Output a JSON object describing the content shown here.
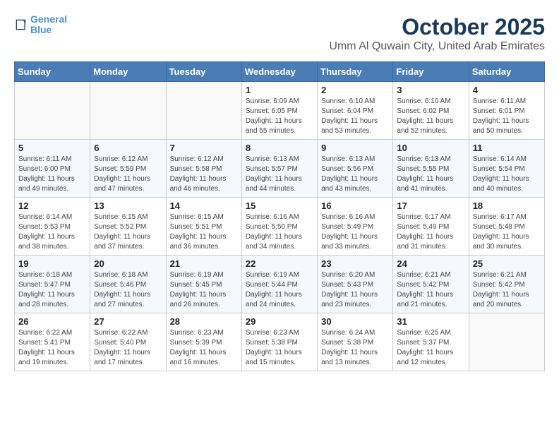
{
  "header": {
    "logo_line1": "General",
    "logo_line2": "Blue",
    "month_title": "October 2025",
    "location": "Umm Al Quwain City, United Arab Emirates"
  },
  "weekdays": [
    "Sunday",
    "Monday",
    "Tuesday",
    "Wednesday",
    "Thursday",
    "Friday",
    "Saturday"
  ],
  "weeks": [
    [
      {
        "day": "",
        "sunrise": "",
        "sunset": "",
        "daylight": ""
      },
      {
        "day": "",
        "sunrise": "",
        "sunset": "",
        "daylight": ""
      },
      {
        "day": "",
        "sunrise": "",
        "sunset": "",
        "daylight": ""
      },
      {
        "day": "1",
        "sunrise": "Sunrise: 6:09 AM",
        "sunset": "Sunset: 6:05 PM",
        "daylight": "Daylight: 11 hours and 55 minutes."
      },
      {
        "day": "2",
        "sunrise": "Sunrise: 6:10 AM",
        "sunset": "Sunset: 6:04 PM",
        "daylight": "Daylight: 11 hours and 53 minutes."
      },
      {
        "day": "3",
        "sunrise": "Sunrise: 6:10 AM",
        "sunset": "Sunset: 6:02 PM",
        "daylight": "Daylight: 11 hours and 52 minutes."
      },
      {
        "day": "4",
        "sunrise": "Sunrise: 6:11 AM",
        "sunset": "Sunset: 6:01 PM",
        "daylight": "Daylight: 11 hours and 50 minutes."
      }
    ],
    [
      {
        "day": "5",
        "sunrise": "Sunrise: 6:11 AM",
        "sunset": "Sunset: 6:00 PM",
        "daylight": "Daylight: 11 hours and 49 minutes."
      },
      {
        "day": "6",
        "sunrise": "Sunrise: 6:12 AM",
        "sunset": "Sunset: 5:59 PM",
        "daylight": "Daylight: 11 hours and 47 minutes."
      },
      {
        "day": "7",
        "sunrise": "Sunrise: 6:12 AM",
        "sunset": "Sunset: 5:58 PM",
        "daylight": "Daylight: 11 hours and 46 minutes."
      },
      {
        "day": "8",
        "sunrise": "Sunrise: 6:13 AM",
        "sunset": "Sunset: 5:57 PM",
        "daylight": "Daylight: 11 hours and 44 minutes."
      },
      {
        "day": "9",
        "sunrise": "Sunrise: 6:13 AM",
        "sunset": "Sunset: 5:56 PM",
        "daylight": "Daylight: 11 hours and 43 minutes."
      },
      {
        "day": "10",
        "sunrise": "Sunrise: 6:13 AM",
        "sunset": "Sunset: 5:55 PM",
        "daylight": "Daylight: 11 hours and 41 minutes."
      },
      {
        "day": "11",
        "sunrise": "Sunrise: 6:14 AM",
        "sunset": "Sunset: 5:54 PM",
        "daylight": "Daylight: 11 hours and 40 minutes."
      }
    ],
    [
      {
        "day": "12",
        "sunrise": "Sunrise: 6:14 AM",
        "sunset": "Sunset: 5:53 PM",
        "daylight": "Daylight: 11 hours and 38 minutes."
      },
      {
        "day": "13",
        "sunrise": "Sunrise: 6:15 AM",
        "sunset": "Sunset: 5:52 PM",
        "daylight": "Daylight: 11 hours and 37 minutes."
      },
      {
        "day": "14",
        "sunrise": "Sunrise: 6:15 AM",
        "sunset": "Sunset: 5:51 PM",
        "daylight": "Daylight: 11 hours and 36 minutes."
      },
      {
        "day": "15",
        "sunrise": "Sunrise: 6:16 AM",
        "sunset": "Sunset: 5:50 PM",
        "daylight": "Daylight: 11 hours and 34 minutes."
      },
      {
        "day": "16",
        "sunrise": "Sunrise: 6:16 AM",
        "sunset": "Sunset: 5:49 PM",
        "daylight": "Daylight: 11 hours and 33 minutes."
      },
      {
        "day": "17",
        "sunrise": "Sunrise: 6:17 AM",
        "sunset": "Sunset: 5:49 PM",
        "daylight": "Daylight: 11 hours and 31 minutes."
      },
      {
        "day": "18",
        "sunrise": "Sunrise: 6:17 AM",
        "sunset": "Sunset: 5:48 PM",
        "daylight": "Daylight: 11 hours and 30 minutes."
      }
    ],
    [
      {
        "day": "19",
        "sunrise": "Sunrise: 6:18 AM",
        "sunset": "Sunset: 5:47 PM",
        "daylight": "Daylight: 11 hours and 28 minutes."
      },
      {
        "day": "20",
        "sunrise": "Sunrise: 6:18 AM",
        "sunset": "Sunset: 5:46 PM",
        "daylight": "Daylight: 11 hours and 27 minutes."
      },
      {
        "day": "21",
        "sunrise": "Sunrise: 6:19 AM",
        "sunset": "Sunset: 5:45 PM",
        "daylight": "Daylight: 11 hours and 26 minutes."
      },
      {
        "day": "22",
        "sunrise": "Sunrise: 6:19 AM",
        "sunset": "Sunset: 5:44 PM",
        "daylight": "Daylight: 11 hours and 24 minutes."
      },
      {
        "day": "23",
        "sunrise": "Sunrise: 6:20 AM",
        "sunset": "Sunset: 5:43 PM",
        "daylight": "Daylight: 11 hours and 23 minutes."
      },
      {
        "day": "24",
        "sunrise": "Sunrise: 6:21 AM",
        "sunset": "Sunset: 5:42 PM",
        "daylight": "Daylight: 11 hours and 21 minutes."
      },
      {
        "day": "25",
        "sunrise": "Sunrise: 6:21 AM",
        "sunset": "Sunset: 5:42 PM",
        "daylight": "Daylight: 11 hours and 20 minutes."
      }
    ],
    [
      {
        "day": "26",
        "sunrise": "Sunrise: 6:22 AM",
        "sunset": "Sunset: 5:41 PM",
        "daylight": "Daylight: 11 hours and 19 minutes."
      },
      {
        "day": "27",
        "sunrise": "Sunrise: 6:22 AM",
        "sunset": "Sunset: 5:40 PM",
        "daylight": "Daylight: 11 hours and 17 minutes."
      },
      {
        "day": "28",
        "sunrise": "Sunrise: 6:23 AM",
        "sunset": "Sunset: 5:39 PM",
        "daylight": "Daylight: 11 hours and 16 minutes."
      },
      {
        "day": "29",
        "sunrise": "Sunrise: 6:23 AM",
        "sunset": "Sunset: 5:38 PM",
        "daylight": "Daylight: 11 hours and 15 minutes."
      },
      {
        "day": "30",
        "sunrise": "Sunrise: 6:24 AM",
        "sunset": "Sunset: 5:38 PM",
        "daylight": "Daylight: 11 hours and 13 minutes."
      },
      {
        "day": "31",
        "sunrise": "Sunrise: 6:25 AM",
        "sunset": "Sunset: 5:37 PM",
        "daylight": "Daylight: 11 hours and 12 minutes."
      },
      {
        "day": "",
        "sunrise": "",
        "sunset": "",
        "daylight": ""
      }
    ]
  ]
}
